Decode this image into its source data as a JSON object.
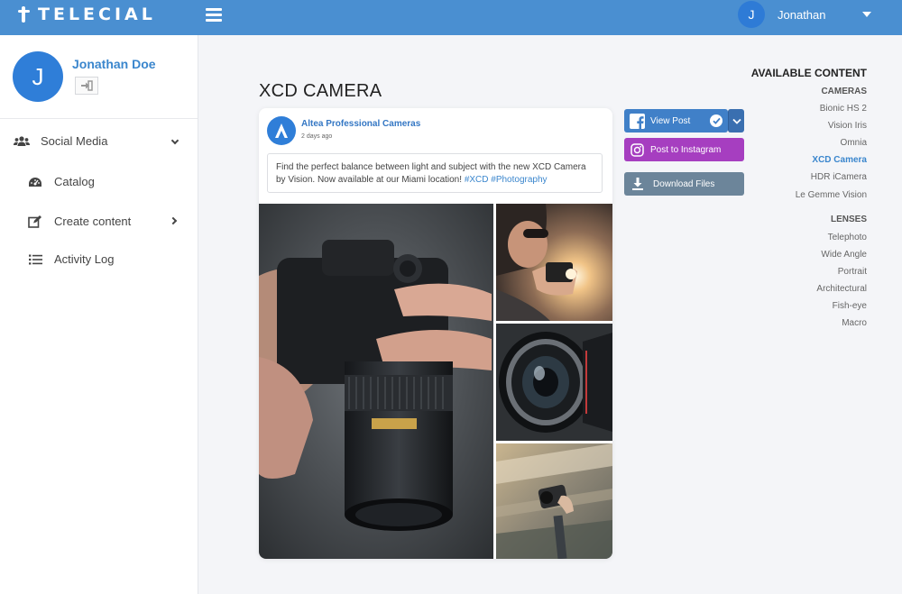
{
  "brand": {
    "name": "TELECIAL"
  },
  "topbar": {
    "user_initial": "J",
    "user_name": "Jonathan"
  },
  "sidebar": {
    "profile": {
      "initial": "J",
      "name": "Jonathan Doe"
    },
    "items": [
      {
        "label": "Social Media",
        "icon": "users-icon"
      },
      {
        "label": "Catalog",
        "icon": "dashboard-icon"
      },
      {
        "label": "Create content",
        "icon": "edit-icon"
      },
      {
        "label": "Activity Log",
        "icon": "list-icon"
      }
    ]
  },
  "main": {
    "title": "XCD CAMERA",
    "post": {
      "page_name": "Altea Professional Cameras",
      "time": "2 days ago",
      "text": "Find the perfect balance between light and subject with the new XCD Camera by Vision. Now available at our Miami location!",
      "hashtags": "#XCD #Photography"
    }
  },
  "actions": {
    "view_post": "View Post",
    "post_instagram": "Post to Instagram",
    "download_files": "Download Files"
  },
  "available_content": {
    "heading": "AVAILABLE CONTENT",
    "cameras_heading": "CAMERAS",
    "cameras": [
      "Bionic HS 2",
      "Vision Iris",
      "Omnia",
      "XCD Camera",
      "HDR iCamera",
      "Le Gemme Vision"
    ],
    "active_camera": "XCD Camera",
    "lenses_heading": "LENSES",
    "lenses": [
      "Telephoto",
      "Wide Angle",
      "Portrait",
      "Architectural",
      "Fish-eye",
      "Macro"
    ]
  },
  "colors": {
    "topbar": "#4a8fd1",
    "accent": "#3a86cd",
    "facebook": "#4080c8",
    "instagram": "#a63ec0",
    "download": "#6c859a"
  }
}
